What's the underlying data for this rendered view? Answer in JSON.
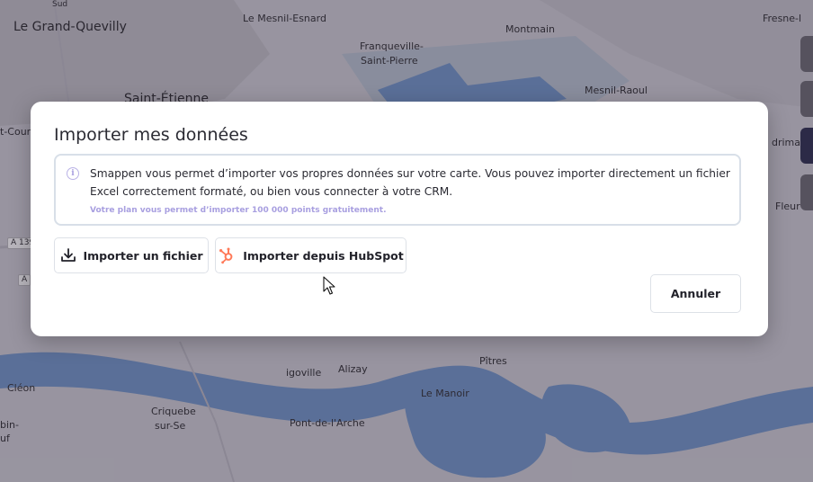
{
  "map": {
    "labels": [
      {
        "id": "le-grand-quevilly",
        "text": "Le Grand-Quevilly"
      },
      {
        "id": "le-mesnil-esnard",
        "text": "Le Mesnil-Esnard"
      },
      {
        "id": "montmain",
        "text": "Montmain"
      },
      {
        "id": "fresne",
        "text": "Fresne-l"
      },
      {
        "id": "franqueville",
        "text": "Franqueville-"
      },
      {
        "id": "saint-pierre",
        "text": "Saint-Pierre"
      },
      {
        "id": "mesnil-raoul",
        "text": "Mesnil-Raoul"
      },
      {
        "id": "saint-etienne",
        "text": "Saint-Étienne"
      },
      {
        "id": "st-cour",
        "text": "t-Cour"
      },
      {
        "id": "fleur",
        "text": "Fleur"
      },
      {
        "id": "drima",
        "text": "drima"
      },
      {
        "id": "pitres",
        "text": "Pîtres"
      },
      {
        "id": "alizay",
        "text": "Alizay"
      },
      {
        "id": "igoville",
        "text": "igoville"
      },
      {
        "id": "cleon",
        "text": "Cléon"
      },
      {
        "id": "le-manoir",
        "text": "Le Manoir"
      },
      {
        "id": "criquebeuf",
        "text": "Criquebe"
      },
      {
        "id": "sur-seine",
        "text": "sur-Se"
      },
      {
        "id": "pont-de-larche",
        "text": "Pont-de-l'Arche"
      },
      {
        "id": "bin",
        "text": "bin-"
      },
      {
        "id": "uf",
        "text": "uf"
      },
      {
        "id": "sud",
        "text": "Sud"
      }
    ],
    "shields": [
      {
        "id": "a139",
        "text": "A 139"
      },
      {
        "id": "a",
        "text": "A"
      }
    ]
  },
  "modal": {
    "title": "Importer mes données",
    "info": {
      "text": "Smappen vous permet d’importer vos propres données sur votre carte. Vous pouvez importer directement un fichier Excel correctement formaté, ou bien vous connecter à votre CRM.",
      "note": "Votre plan vous permet d’importer 100 000 points gratuitement."
    },
    "buttons": {
      "import_file": "Importer un fichier",
      "import_hubspot": "Importer depuis HubSpot",
      "cancel": "Annuler"
    }
  },
  "colors": {
    "accent": "#a89fe0",
    "hubspot": "#ff7a59",
    "water": "#7fa6dc",
    "overlay": "#28243a"
  },
  "icons": {
    "import_file": "download-icon",
    "import_hubspot": "hubspot-icon",
    "info": "info-icon",
    "cursor": "mouse-pointer-icon"
  }
}
